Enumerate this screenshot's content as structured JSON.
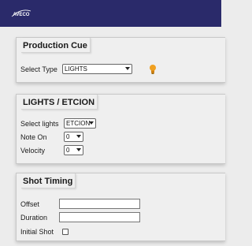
{
  "header": {
    "logo_text": "AVECO"
  },
  "production_cue": {
    "title": "Production Cue",
    "select_type_label": "Select Type",
    "select_type_value": "LIGHTS",
    "lightbulb_icon": "lightbulb-icon"
  },
  "lights_etcion": {
    "title": "LIGHTS / ETCION",
    "select_lights_label": "Select lights",
    "select_lights_value": "ETCION",
    "note_on_label": "Note On",
    "note_on_value": "0",
    "velocity_label": "Velocity",
    "velocity_value": "0"
  },
  "shot_timing": {
    "title": "Shot Timing",
    "offset_label": "Offset",
    "offset_value": "",
    "duration_label": "Duration",
    "duration_value": "",
    "initial_shot_label": "Initial Shot",
    "initial_shot_checked": false
  },
  "colors": {
    "header_bg": "#2a2a6a",
    "panel_bg": "#efefef",
    "bulb": "#f0a020"
  }
}
